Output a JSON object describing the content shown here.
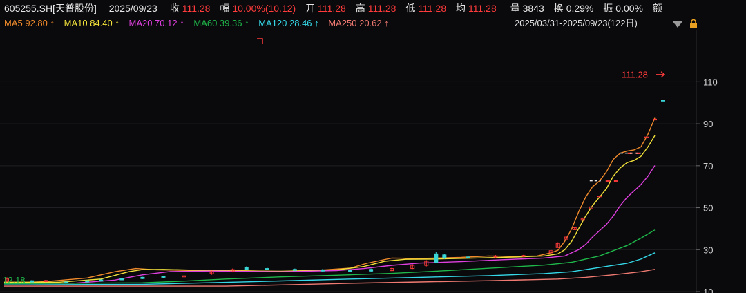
{
  "header": {
    "code": "605255.SH[天普股份]",
    "date": "2025/09/23",
    "close_label": "收",
    "close_value": "111.28",
    "change_label": "幅",
    "change_value": "10.00%(10.12)",
    "open_label": "开",
    "open_value": "111.28",
    "high_label": "高",
    "high_value": "111.28",
    "low_label": "低",
    "low_value": "111.28",
    "avg_label": "均",
    "avg_value": "111.28",
    "volume_label": "量",
    "volume_value": "3843",
    "turnover_label": "换",
    "turnover_value": "0.29%",
    "amplitude_label": "振",
    "amplitude_value": "0.00%",
    "amount_label": "额"
  },
  "ma_legend": [
    {
      "label": "MA5 92.80",
      "arrow": "↑",
      "color": "#f08a2b"
    },
    {
      "label": "MA10 84.40",
      "arrow": "↑",
      "color": "#f2e23a"
    },
    {
      "label": "MA20 70.12",
      "arrow": "↑",
      "color": "#e040e0"
    },
    {
      "label": "MA60 39.36",
      "arrow": "↑",
      "color": "#1fb84a"
    },
    {
      "label": "MA120 28.46",
      "arrow": "↑",
      "color": "#35d8e8"
    },
    {
      "label": "MA250 20.62",
      "arrow": "↑",
      "color": "#f07a72"
    }
  ],
  "range_text": "2025/03/31-2025/09/23(122日)",
  "chart_data": {
    "type": "line",
    "subtype": "candlestick-with-moving-averages",
    "ylim": [
      10,
      120
    ],
    "yticks": [
      "110",
      "90",
      "70",
      "50",
      "30",
      "10"
    ],
    "last_price_label": "111.28",
    "low_label": "12.18",
    "x_count": 122,
    "series": [
      {
        "name": "MA5",
        "color": "#f08a2b",
        "points": [
          [
            0,
            14
          ],
          [
            30,
            14.8
          ],
          [
            60,
            16.5
          ],
          [
            80,
            19.5
          ],
          [
            95,
            21
          ],
          [
            110,
            20.4
          ],
          [
            140,
            20
          ],
          [
            170,
            20
          ],
          [
            200,
            19.6
          ],
          [
            230,
            20.3
          ],
          [
            250,
            21.2
          ],
          [
            262,
            23.5
          ],
          [
            280,
            26
          ],
          [
            300,
            25.8
          ],
          [
            330,
            26.3
          ],
          [
            350,
            27
          ],
          [
            370,
            26.8
          ],
          [
            385,
            27
          ],
          [
            395,
            28.5
          ],
          [
            400,
            29.7
          ],
          [
            405,
            34
          ],
          [
            410,
            40
          ],
          [
            415,
            48
          ],
          [
            420,
            55
          ],
          [
            425,
            60
          ],
          [
            430,
            62.7
          ],
          [
            435,
            67
          ],
          [
            440,
            73
          ],
          [
            445,
            76
          ],
          [
            450,
            77
          ],
          [
            455,
            77.5
          ],
          [
            460,
            79
          ],
          [
            465,
            85
          ],
          [
            470,
            92.8
          ]
        ]
      },
      {
        "name": "MA10",
        "color": "#f2e23a",
        "points": [
          [
            0,
            14.5
          ],
          [
            40,
            14.5
          ],
          [
            70,
            16
          ],
          [
            90,
            19.5
          ],
          [
            100,
            20.5
          ],
          [
            115,
            20.6
          ],
          [
            150,
            20
          ],
          [
            200,
            19.7
          ],
          [
            240,
            20.3
          ],
          [
            260,
            22
          ],
          [
            275,
            24.5
          ],
          [
            290,
            25.4
          ],
          [
            310,
            25.5
          ],
          [
            340,
            26
          ],
          [
            370,
            26.5
          ],
          [
            390,
            27
          ],
          [
            400,
            28
          ],
          [
            405,
            30
          ],
          [
            410,
            34
          ],
          [
            415,
            40
          ],
          [
            420,
            46
          ],
          [
            425,
            51
          ],
          [
            430,
            55
          ],
          [
            435,
            59
          ],
          [
            440,
            65
          ],
          [
            445,
            69
          ],
          [
            450,
            71.5
          ],
          [
            455,
            72.5
          ],
          [
            460,
            74.5
          ],
          [
            465,
            79
          ],
          [
            470,
            84.4
          ]
        ]
      },
      {
        "name": "MA20",
        "color": "#e040e0",
        "points": [
          [
            0,
            14
          ],
          [
            50,
            14
          ],
          [
            80,
            15.5
          ],
          [
            100,
            18
          ],
          [
            120,
            19.6
          ],
          [
            150,
            19.8
          ],
          [
            200,
            19.5
          ],
          [
            240,
            20
          ],
          [
            260,
            21
          ],
          [
            280,
            22.5
          ],
          [
            300,
            23.6
          ],
          [
            330,
            24.3
          ],
          [
            360,
            25.2
          ],
          [
            390,
            26
          ],
          [
            405,
            27
          ],
          [
            410,
            28.5
          ],
          [
            415,
            30
          ],
          [
            420,
            32.5
          ],
          [
            425,
            36
          ],
          [
            430,
            39
          ],
          [
            435,
            42
          ],
          [
            440,
            46
          ],
          [
            445,
            51
          ],
          [
            450,
            55
          ],
          [
            455,
            58
          ],
          [
            460,
            61
          ],
          [
            465,
            65
          ],
          [
            470,
            70.1
          ]
        ]
      },
      {
        "name": "MA60",
        "color": "#1fb84a",
        "points": [
          [
            0,
            13.8
          ],
          [
            100,
            14.2
          ],
          [
            130,
            15
          ],
          [
            160,
            16
          ],
          [
            200,
            17
          ],
          [
            240,
            17.8
          ],
          [
            280,
            18.7
          ],
          [
            320,
            20
          ],
          [
            360,
            21.5
          ],
          [
            390,
            22.6
          ],
          [
            410,
            24
          ],
          [
            420,
            25.5
          ],
          [
            430,
            27
          ],
          [
            440,
            29.5
          ],
          [
            450,
            32
          ],
          [
            460,
            35.5
          ],
          [
            470,
            39.4
          ]
        ]
      },
      {
        "name": "MA120",
        "color": "#35d8e8",
        "points": [
          [
            0,
            13.2
          ],
          [
            100,
            13.5
          ],
          [
            160,
            14.4
          ],
          [
            200,
            15.1
          ],
          [
            250,
            16
          ],
          [
            300,
            16.8
          ],
          [
            350,
            17.6
          ],
          [
            390,
            18.6
          ],
          [
            410,
            19.5
          ],
          [
            430,
            21.5
          ],
          [
            450,
            23.5
          ],
          [
            460,
            25.5
          ],
          [
            470,
            28.5
          ]
        ]
      },
      {
        "name": "MA250",
        "color": "#f07a72",
        "points": [
          [
            0,
            12.6
          ],
          [
            160,
            12.6
          ],
          [
            200,
            13.2
          ],
          [
            250,
            14
          ],
          [
            300,
            14.6
          ],
          [
            350,
            15.2
          ],
          [
            400,
            16
          ],
          [
            420,
            16.8
          ],
          [
            440,
            18
          ],
          [
            460,
            19.5
          ],
          [
            470,
            20.6
          ]
        ]
      }
    ],
    "candles": [
      {
        "x": 2,
        "o": 15,
        "c": 16.2,
        "h": 16.8,
        "l": 14.5,
        "up": true
      },
      {
        "x": 20,
        "o": 15.2,
        "c": 14.6,
        "h": 15.5,
        "l": 14.2,
        "up": false
      },
      {
        "x": 30,
        "o": 14.8,
        "c": 15.3,
        "h": 15.6,
        "l": 14.6,
        "up": true
      },
      {
        "x": 45,
        "o": 14.2,
        "c": 14.6,
        "h": 14.8,
        "l": 14,
        "up": false
      },
      {
        "x": 60,
        "o": 14.6,
        "c": 15.2,
        "h": 15.4,
        "l": 14.5,
        "up": false
      },
      {
        "x": 70,
        "o": 15,
        "c": 15.6,
        "h": 15.8,
        "l": 14.8,
        "up": false
      },
      {
        "x": 85,
        "o": 15.6,
        "c": 16.2,
        "h": 16.4,
        "l": 15.4,
        "up": false
      },
      {
        "x": 100,
        "o": 16.2,
        "c": 16.8,
        "h": 17,
        "l": 16,
        "up": false
      },
      {
        "x": 115,
        "o": 16.8,
        "c": 17.2,
        "h": 17.4,
        "l": 16.5,
        "up": false
      },
      {
        "x": 130,
        "o": 17,
        "c": 17.5,
        "h": 17.8,
        "l": 16.8,
        "up": true
      },
      {
        "x": 150,
        "o": 18.5,
        "c": 19.5,
        "h": 20,
        "l": 18,
        "up": true
      },
      {
        "x": 165,
        "o": 19.5,
        "c": 20.5,
        "h": 21,
        "l": 19.2,
        "up": true
      },
      {
        "x": 175,
        "o": 20.5,
        "c": 21.6,
        "h": 22,
        "l": 20.2,
        "up": false
      },
      {
        "x": 190,
        "o": 20.6,
        "c": 21,
        "h": 21.4,
        "l": 20.2,
        "up": false
      },
      {
        "x": 210,
        "o": 20.2,
        "c": 20.6,
        "h": 21,
        "l": 19.8,
        "up": false
      },
      {
        "x": 230,
        "o": 19.8,
        "c": 20.4,
        "h": 20.8,
        "l": 19.5,
        "up": false
      },
      {
        "x": 250,
        "o": 19.6,
        "c": 20.2,
        "h": 20.6,
        "l": 19.3,
        "up": false
      },
      {
        "x": 265,
        "o": 19.8,
        "c": 20.6,
        "h": 21,
        "l": 19.5,
        "up": false
      },
      {
        "x": 280,
        "o": 20,
        "c": 21,
        "h": 21.4,
        "l": 19.8,
        "up": true
      },
      {
        "x": 295,
        "o": 21,
        "c": 22.5,
        "h": 23,
        "l": 20.8,
        "up": true
      },
      {
        "x": 305,
        "o": 22.5,
        "c": 24.5,
        "h": 25,
        "l": 22,
        "up": true
      },
      {
        "x": 312,
        "o": 24,
        "c": 28,
        "h": 29,
        "l": 23.5,
        "up": false
      },
      {
        "x": 318,
        "o": 26,
        "c": 27.5,
        "h": 28,
        "l": 25.5,
        "up": false
      },
      {
        "x": 335,
        "o": 26,
        "c": 26.5,
        "h": 27,
        "l": 25.5,
        "up": false
      },
      {
        "x": 355,
        "o": 26.5,
        "c": 27,
        "h": 27.4,
        "l": 26,
        "up": true
      },
      {
        "x": 375,
        "o": 26.8,
        "c": 27.2,
        "h": 27.5,
        "l": 26.5,
        "up": true
      },
      {
        "x": 395,
        "o": 28.5,
        "c": 29.5,
        "h": 30,
        "l": 28.3,
        "up": true
      },
      {
        "x": 400,
        "o": 31,
        "c": 33,
        "h": 33.5,
        "l": 31,
        "up": true
      },
      {
        "x": 406,
        "o": 35,
        "c": 36,
        "h": 36.3,
        "l": 35,
        "up": true
      },
      {
        "x": 412,
        "o": 39.5,
        "c": 40.5,
        "h": 40.8,
        "l": 39.5,
        "up": true
      },
      {
        "x": 418,
        "o": 44,
        "c": 45,
        "h": 45.3,
        "l": 44,
        "up": true
      },
      {
        "x": 424,
        "o": 49.5,
        "c": 50.4,
        "h": 50.7,
        "l": 49.5,
        "up": true
      },
      {
        "x": 430,
        "o": 55.2,
        "c": 55.6,
        "h": 55.8,
        "l": 55.2,
        "up": true
      },
      {
        "x": 436,
        "o": 62.7,
        "c": 62.9,
        "h": 63,
        "l": 62.7,
        "up": true
      },
      {
        "x": 442,
        "o": 62.7,
        "c": 62.9,
        "h": 63,
        "l": 62.7,
        "up": true
      },
      {
        "x": 452,
        "o": 75.9,
        "c": 76.1,
        "h": 76.2,
        "l": 75.9,
        "up": true
      },
      {
        "x": 458,
        "o": 75.9,
        "c": 76.1,
        "h": 76.2,
        "l": 75.9,
        "up": true
      },
      {
        "x": 464,
        "o": 83.5,
        "c": 83.7,
        "h": 83.8,
        "l": 83.5,
        "up": true
      },
      {
        "x": 470,
        "o": 92,
        "c": 92.2,
        "h": 92.3,
        "l": 92,
        "up": true
      },
      {
        "x": 476,
        "o": 101,
        "c": 101.2,
        "h": 101.4,
        "l": 100.8,
        "up": false
      }
    ]
  }
}
